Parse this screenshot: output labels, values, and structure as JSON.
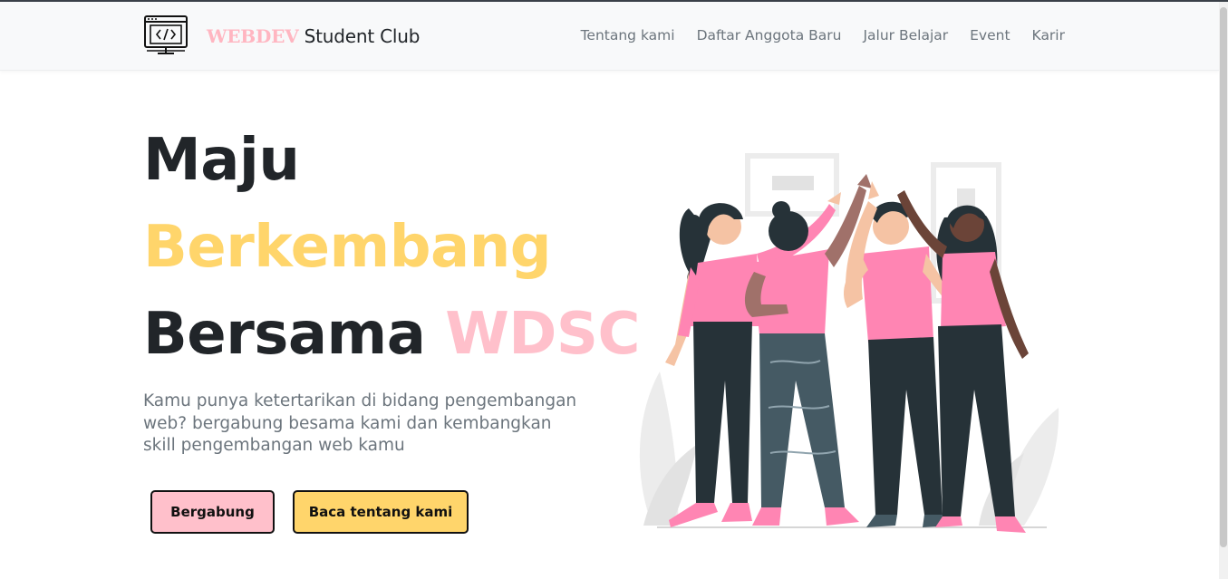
{
  "brand": {
    "accent": "WEBDEV",
    "name": " Student Club",
    "logo_icon": "code-monitor-icon"
  },
  "nav": {
    "items": [
      {
        "label": "Tentang kami"
      },
      {
        "label": "Daftar Anggota Baru"
      },
      {
        "label": "Jalur Belajar"
      },
      {
        "label": "Event"
      },
      {
        "label": "Karir"
      }
    ]
  },
  "hero": {
    "line1": "Maju",
    "line2": "Berkembang",
    "line3_prefix": "Bersama ",
    "line3_accent": "WDSC",
    "lead": "Kamu punya ketertarikan di bidang pengembangan web? bergabung besama kami dan kembangkan skill pengembangan web kamu",
    "primary_button": "Bergabung",
    "secondary_button": "Baca tentang kami",
    "illustration": "team-high-five-illustration"
  },
  "colors": {
    "pink": "#ffc0cb",
    "yellow": "#ffd56b",
    "dark": "#212529",
    "muted": "#6c757d",
    "shirt": "#ff85b3"
  }
}
